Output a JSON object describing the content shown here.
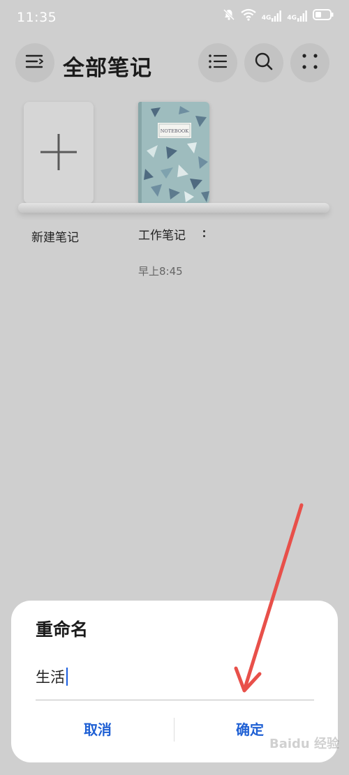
{
  "status_bar": {
    "time": "11:35",
    "signal1_label": "4G",
    "signal2_label": "4G",
    "icons": [
      "mute-bell-icon",
      "wifi-icon",
      "signal-4g-icon",
      "signal-4g-icon",
      "battery-icon"
    ]
  },
  "header": {
    "title": "全部笔记",
    "menu_icon": "menu-icon",
    "list_icon": "list-view-icon",
    "search_icon": "search-icon",
    "more_icon": "more-dots-icon"
  },
  "shelf": {
    "new_note_label": "新建笔记",
    "notebook": {
      "name": "工作笔记",
      "cover_text": "NOTEBOOK",
      "time": "早上8:45"
    }
  },
  "dialog": {
    "title": "重命名",
    "input_value": "生活",
    "cancel_label": "取消",
    "confirm_label": "确定"
  },
  "watermark": "Baidu 经验",
  "colors": {
    "background": "#cfcfcf",
    "accent": "#1f60d4",
    "annotation_arrow": "#e8504a",
    "notebook_cover": "#9ebcbe"
  }
}
